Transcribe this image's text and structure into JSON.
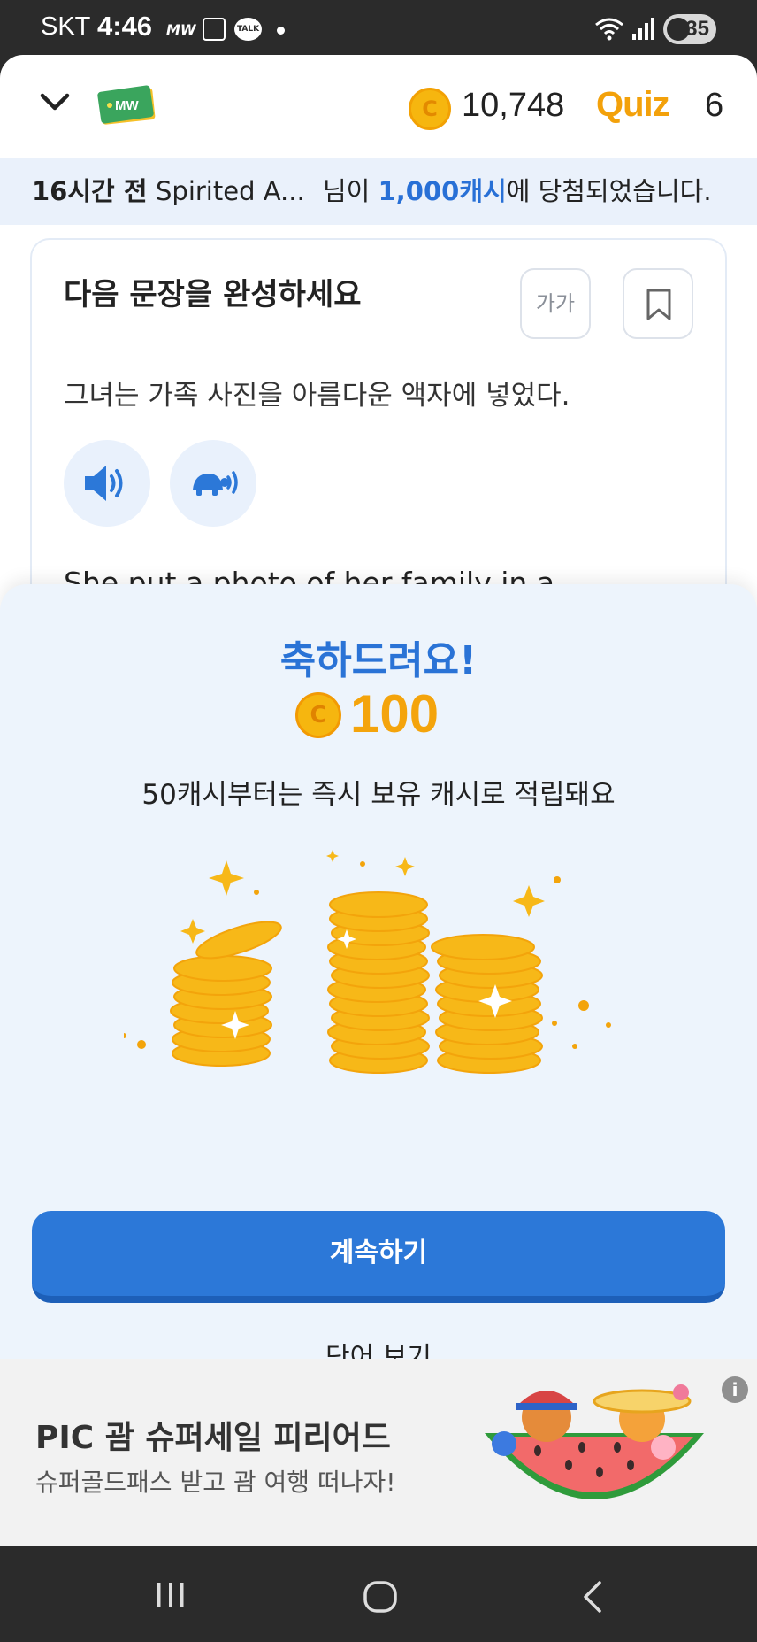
{
  "status_bar": {
    "carrier": "SKT",
    "time": "4:46",
    "mw_text": "MW",
    "talk_text": "TALK",
    "battery": "35"
  },
  "header": {
    "coin_count": "10,748",
    "quiz_logo": "Quiz",
    "quiz_count": "6",
    "logo_text": "MW",
    "icons": [
      "chevron-down-icon",
      "coin-icon"
    ]
  },
  "ticker": {
    "time": "16시간 전",
    "name": "Spirited A...",
    "pre": "님이 ",
    "prize": "1,000캐시",
    "post": "에 당첨되었습니다."
  },
  "question": {
    "title": "다음 문장을 완성하세요",
    "font_button": "가가",
    "sentence": "그녀는 가족 사진을 아름다운 액자에 넣었다.",
    "answer_partial": "She put a photo of her family in a"
  },
  "reward": {
    "congrats": "축하드려요!",
    "amount": "100",
    "note": "50캐시부터는 즉시 보유 캐시로 적립돼요",
    "continue_label": "계속하기",
    "words_label": "단어 보기"
  },
  "ad": {
    "title": "PIC 괌 슈퍼세일 피리어드",
    "subtitle": "슈퍼골드패스 받고 괌 여행 떠나자!",
    "info": "i"
  },
  "colors": {
    "primary_blue": "#2c78d8",
    "coin_gold": "#f6b60f",
    "sheet_bg": "#edf4fc"
  }
}
